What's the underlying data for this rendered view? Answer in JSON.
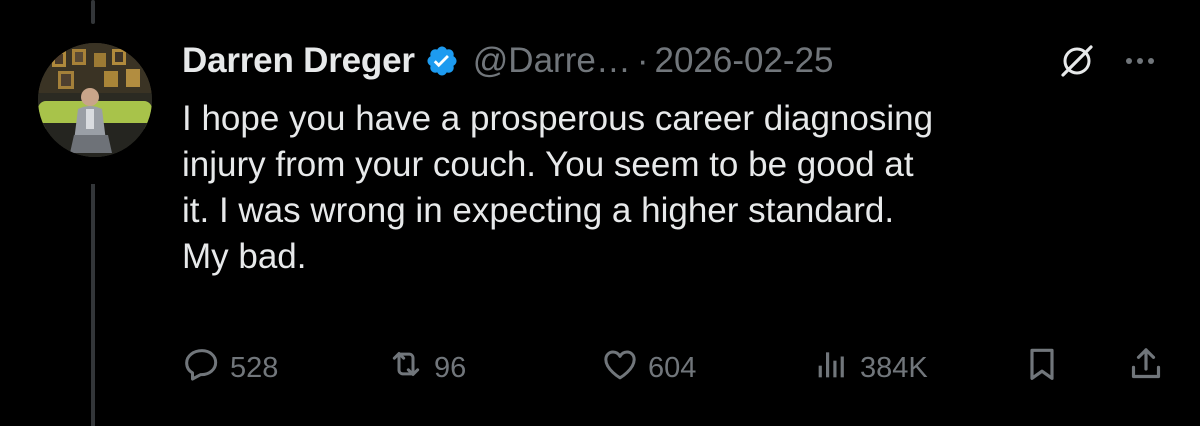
{
  "tweet": {
    "author_name": "Darren Dreger",
    "handle": "@Darre…",
    "separator": "·",
    "date": "2026-02-25",
    "text": "I hope you have a prosperous career diagnosing\ninjury from your couch.  You seem to be good at\nit.  I was wrong in expecting a higher standard.\nMy bad."
  },
  "stats": {
    "replies": "528",
    "reposts": "96",
    "likes": "604",
    "views": "384K"
  },
  "colors": {
    "background": "#000000",
    "text": "#e7e9ea",
    "muted": "#71767b",
    "verified": "#1d9bf0",
    "thread_line": "#333639"
  },
  "icons": [
    "verified-badge-icon",
    "grok-icon",
    "more-icon",
    "reply-icon",
    "repost-icon",
    "like-icon",
    "views-icon",
    "bookmark-icon",
    "share-icon"
  ]
}
